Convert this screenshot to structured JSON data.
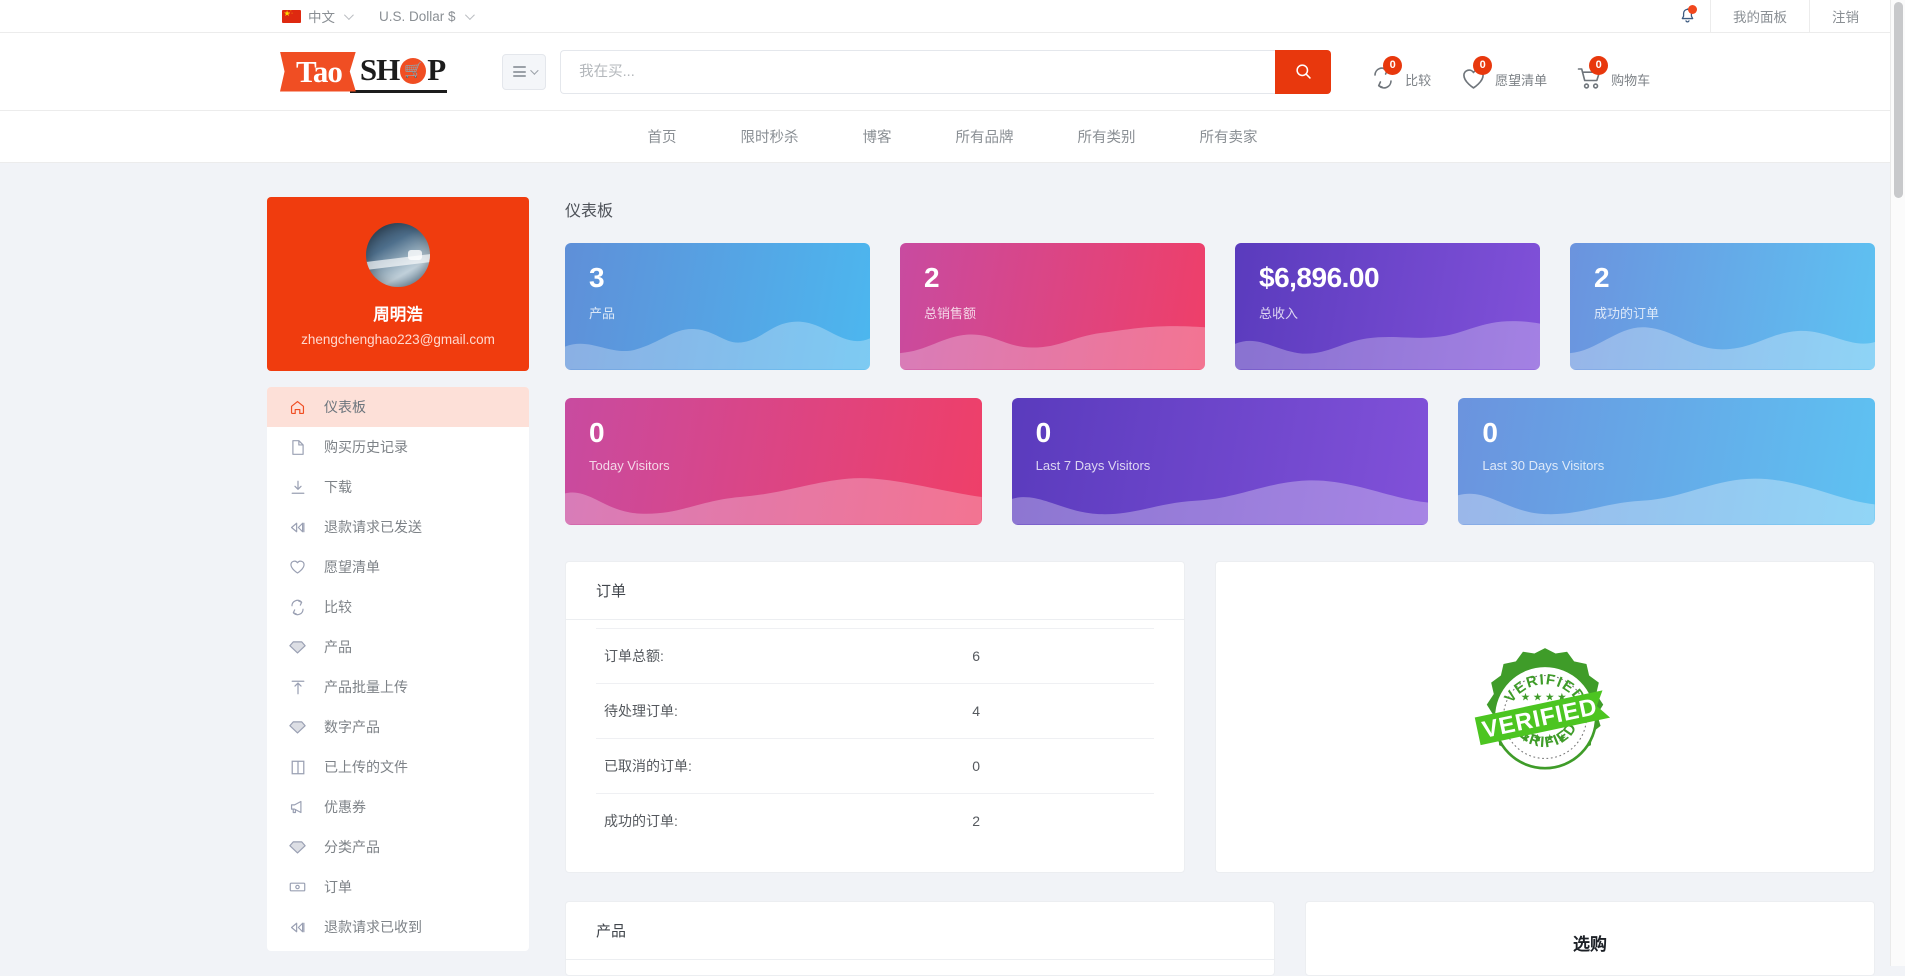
{
  "topbar": {
    "language": "中文",
    "currency": "U.S. Dollar $",
    "notifications_icon": "bell-icon",
    "my_panel": "我的面板",
    "logout": "注销"
  },
  "header": {
    "logo_primary": "Tao",
    "logo_secondary_left": "SH",
    "logo_secondary_right": "P",
    "category_button": "category-menu",
    "search": {
      "placeholder": "我在买...",
      "value": "",
      "button_icon": "search-icon"
    },
    "actions": [
      {
        "icon": "compare-icon",
        "label": "比较",
        "count": "0"
      },
      {
        "icon": "heart-icon",
        "label": "愿望清单",
        "count": "0"
      },
      {
        "icon": "cart-icon",
        "label": "购物车",
        "count": "0"
      }
    ]
  },
  "nav": {
    "items": [
      {
        "label": "首页"
      },
      {
        "label": "限时秒杀"
      },
      {
        "label": "博客"
      },
      {
        "label": "所有品牌"
      },
      {
        "label": "所有类别"
      },
      {
        "label": "所有卖家"
      }
    ]
  },
  "sidebar": {
    "profile": {
      "name": "周明浩",
      "email": "zhengchenghao223@gmail.com"
    },
    "items": [
      {
        "label": "仪表板",
        "icon": "home-icon",
        "active": true
      },
      {
        "label": "购买历史记录",
        "icon": "file-icon",
        "active": false
      },
      {
        "label": "下载",
        "icon": "download-icon",
        "active": false
      },
      {
        "label": "退款请求已发送",
        "icon": "rewind-icon",
        "active": false
      },
      {
        "label": "愿望清单",
        "icon": "heart-icon",
        "active": false
      },
      {
        "label": "比较",
        "icon": "compare-icon",
        "active": false
      },
      {
        "label": "产品",
        "icon": "gem-icon",
        "active": false
      },
      {
        "label": "产品批量上传",
        "icon": "upload-icon",
        "active": false
      },
      {
        "label": "数字产品",
        "icon": "gem-icon",
        "active": false
      },
      {
        "label": "已上传的文件",
        "icon": "book-icon",
        "active": false
      },
      {
        "label": "优惠券",
        "icon": "megaphone-icon",
        "active": false
      },
      {
        "label": "分类产品",
        "icon": "gem-icon",
        "active": false
      },
      {
        "label": "订单",
        "icon": "money-icon",
        "active": false
      },
      {
        "label": "退款请求已收到",
        "icon": "rewind-icon",
        "active": false
      }
    ]
  },
  "main": {
    "page_title": "仪表板",
    "stats_row1": [
      {
        "value": "3",
        "label": "产品",
        "color": "#4cb7ef"
      },
      {
        "value": "2",
        "label": "总销售额",
        "color": "#ef3f68"
      },
      {
        "value": "$6,896.00",
        "label": "总收入",
        "color": "#8151d9"
      },
      {
        "value": "2",
        "label": "成功的订单",
        "color": "#5ec2f2"
      }
    ],
    "stats_row2": [
      {
        "value": "0",
        "label": "Today Visitors",
        "color": "#ef3f68"
      },
      {
        "value": "0",
        "label": "Last 7 Days Visitors",
        "color": "#8151d9"
      },
      {
        "value": "0",
        "label": "Last 30 Days Visitors",
        "color": "#5ec2f2"
      }
    ],
    "orders_panel": {
      "title": "订单",
      "rows": [
        {
          "key": "订单总额:",
          "value": "6"
        },
        {
          "key": "待处理订单:",
          "value": "4"
        },
        {
          "key": "已取消的订单:",
          "value": "0"
        },
        {
          "key": "成功的订单:",
          "value": "2"
        }
      ]
    },
    "verified_badge": {
      "icon": "verified-stamp-icon",
      "text": "VERIFIED",
      "color": "#3f9c29"
    },
    "products_panel": {
      "title": "产品"
    },
    "shop_panel": {
      "title": "选购"
    }
  }
}
